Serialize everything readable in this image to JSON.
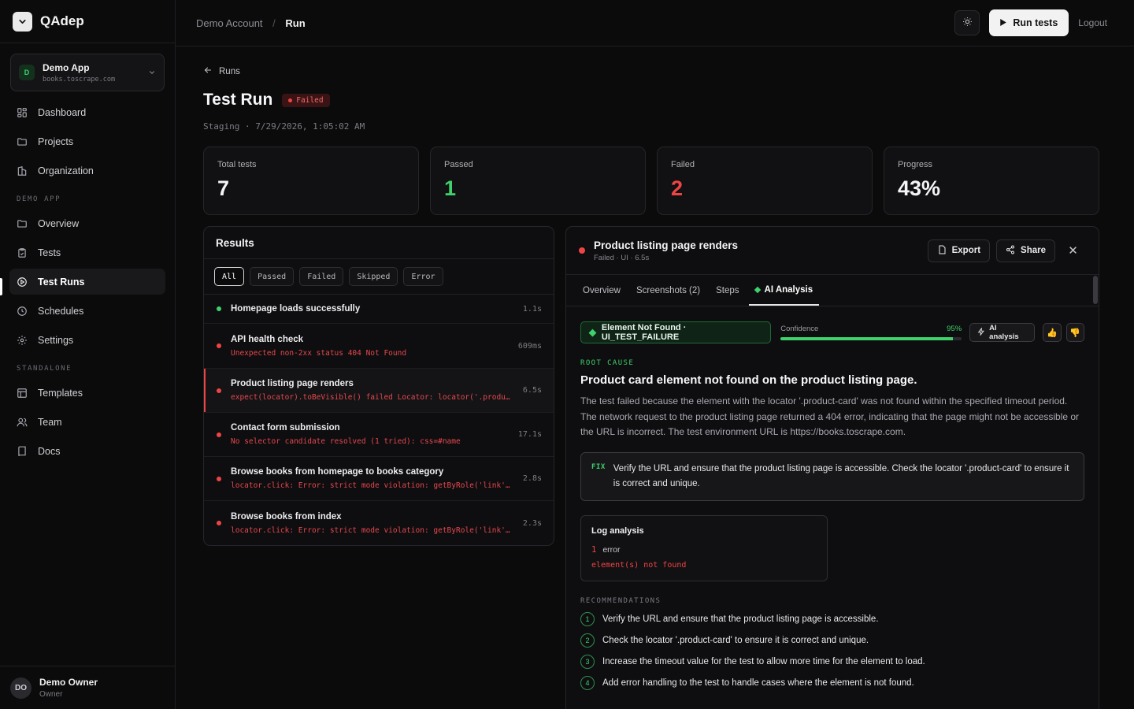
{
  "brand": {
    "name": "QAdep"
  },
  "app_switcher": {
    "avatar": "D",
    "name": "Demo App",
    "url": "books.toscrape.com"
  },
  "nav": {
    "main": [
      {
        "label": "Dashboard",
        "icon": "grid-icon"
      },
      {
        "label": "Projects",
        "icon": "folder-icon"
      },
      {
        "label": "Organization",
        "icon": "building-icon"
      }
    ],
    "section_demo": "DEMO APP",
    "demo": [
      {
        "label": "Overview",
        "icon": "folder-icon"
      },
      {
        "label": "Tests",
        "icon": "clipboard-icon"
      },
      {
        "label": "Test Runs",
        "icon": "play-circle-icon",
        "active": true
      },
      {
        "label": "Schedules",
        "icon": "clock-icon"
      },
      {
        "label": "Settings",
        "icon": "gear-icon"
      }
    ],
    "section_standalone": "STANDALONE",
    "standalone": [
      {
        "label": "Templates",
        "icon": "template-icon"
      },
      {
        "label": "Team",
        "icon": "users-icon"
      },
      {
        "label": "Docs",
        "icon": "book-icon"
      }
    ]
  },
  "user": {
    "initials": "DO",
    "name": "Demo Owner",
    "role": "Owner"
  },
  "breadcrumb": {
    "parent": "Demo Account",
    "separator": "/",
    "current": "Run"
  },
  "header": {
    "run_label": "Run tests",
    "logout_label": "Logout"
  },
  "page": {
    "back_label": "Runs",
    "title": "Test Run",
    "status": "Failed",
    "meta": "Staging · 7/29/2026, 1:05:02 AM"
  },
  "stats": [
    {
      "label": "Total tests",
      "value": "7",
      "tone": "default"
    },
    {
      "label": "Passed",
      "value": "1",
      "tone": "green"
    },
    {
      "label": "Failed",
      "value": "2",
      "tone": "red"
    },
    {
      "label": "Progress",
      "value": "43%",
      "tone": "default"
    }
  ],
  "results": {
    "title": "Results",
    "filters": [
      "All",
      "Passed",
      "Failed",
      "Skipped",
      "Error"
    ],
    "active_filter": "All",
    "rows": [
      {
        "name": "Homepage loads successfully",
        "error": "",
        "duration": "1.1s",
        "status": "passed"
      },
      {
        "name": "API health check",
        "error": "Unexpected non-2xx status 404 Not Found",
        "duration": "609ms",
        "status": "failed"
      },
      {
        "name": "Product listing page renders",
        "error": "expect(locator).toBeVisible() failed Locator: locator('.product-card')",
        "duration": "6.5s",
        "status": "failed",
        "selected": true
      },
      {
        "name": "Contact form submission",
        "error": "No selector candidate resolved (1 tried): css=#name",
        "duration": "17.1s",
        "status": "failed"
      },
      {
        "name": "Browse books from homepage to books category",
        "error": "locator.click: Error: strict mode violation: getByRole('link', { name: 'Books' })",
        "duration": "2.8s",
        "status": "failed"
      },
      {
        "name": "Browse books from index",
        "error": "locator.click: Error: strict mode violation: getByRole('link', { name: 'Books' })",
        "duration": "2.3s",
        "status": "failed"
      }
    ]
  },
  "detail": {
    "title": "Product listing page renders",
    "subtitle": "Failed · UI · 6.5s",
    "export_label": "Export",
    "share_label": "Share",
    "close_label": "✕",
    "tabs": [
      "Overview",
      "Screenshots (2)",
      "Steps",
      "AI Analysis"
    ],
    "active_tab": "AI Analysis",
    "ai": {
      "category": "Element Not Found · UI_TEST_FAILURE",
      "confidence_label": "Confidence",
      "confidence_text": "95%",
      "confidence": 0.95,
      "ai_button": "AI analysis",
      "root_cause_label": "ROOT CAUSE",
      "root_cause_title": "Product card element not found on the product listing page.",
      "root_cause_text": "The test failed because the element with the locator '.product-card' was not found within the specified timeout period. The network request to the product listing page returned a 404 error, indicating that the page might not be accessible or the URL is incorrect. The test environment URL is https://books.toscrape.com.",
      "fix_label": "FIX",
      "fix_text": "Verify the URL and ensure that the product listing page is accessible. Check the locator '.product-card' to ensure it is correct and unique.",
      "log_title": "Log analysis",
      "log_count": "1",
      "log_count_label": "error",
      "log_message": "element(s) not found",
      "recommendations_label": "RECOMMENDATIONS",
      "recommendations": [
        "Verify the URL and ensure that the product listing page is accessible.",
        "Check the locator '.product-card' to ensure it is correct and unique.",
        "Increase the timeout value for the test to allow more time for the element to load.",
        "Add error handling to the test to handle cases where the element is not found."
      ]
    }
  },
  "colors": {
    "accent_green": "#3fd16b",
    "accent_red": "#ef4444",
    "background": "#0b0b0c"
  }
}
